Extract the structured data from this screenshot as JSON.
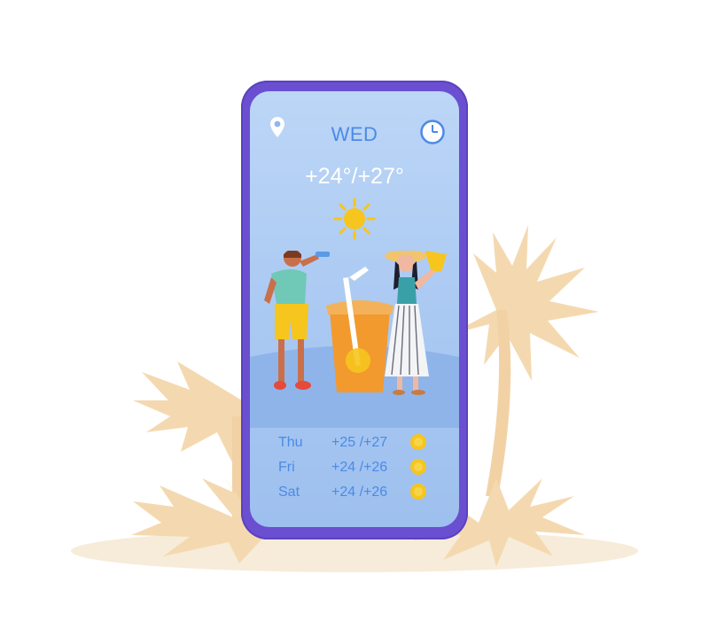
{
  "app": {
    "day": "WED",
    "temperature": "+24°/+27°"
  },
  "forecast": [
    {
      "day": "Thu",
      "range": "+25 /+27",
      "icon": "sun-icon"
    },
    {
      "day": "Fri",
      "range": "+24 /+26",
      "icon": "sun-icon"
    },
    {
      "day": "Sat",
      "range": "+24 /+26",
      "icon": "sun-icon"
    }
  ],
  "icons": {
    "location": "location-pin-icon",
    "clock": "clock-icon",
    "weather": "sun-icon"
  },
  "colors": {
    "phone_frame": "#6a4fd0",
    "screen": "#a9c8f2",
    "accent_text": "#4b8ae6",
    "sun": "#f6c51e",
    "palm": "#f4d9b0",
    "sand": "#f7ecd9"
  }
}
